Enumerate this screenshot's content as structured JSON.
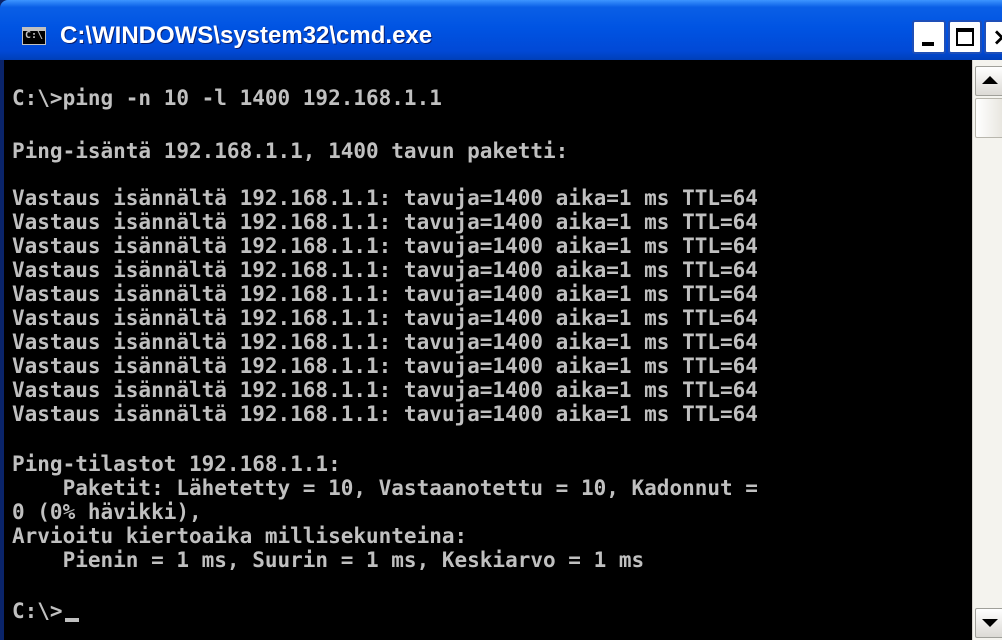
{
  "window": {
    "title": "C:\\WINDOWS\\system32\\cmd.exe",
    "icon_text": "C:\\"
  },
  "console": {
    "lines": [
      "C:\\>ping -n 10 -l 1400 192.168.1.1",
      "",
      "Ping-isäntä 192.168.1.1, 1400 tavun paketti:",
      "",
      "Vastaus isännältä 192.168.1.1: tavuja=1400 aika=1 ms TTL=64",
      "Vastaus isännältä 192.168.1.1: tavuja=1400 aika=1 ms TTL=64",
      "Vastaus isännältä 192.168.1.1: tavuja=1400 aika=1 ms TTL=64",
      "Vastaus isännältä 192.168.1.1: tavuja=1400 aika=1 ms TTL=64",
      "Vastaus isännältä 192.168.1.1: tavuja=1400 aika=1 ms TTL=64",
      "Vastaus isännältä 192.168.1.1: tavuja=1400 aika=1 ms TTL=64",
      "Vastaus isännältä 192.168.1.1: tavuja=1400 aika=1 ms TTL=64",
      "Vastaus isännältä 192.168.1.1: tavuja=1400 aika=1 ms TTL=64",
      "Vastaus isännältä 192.168.1.1: tavuja=1400 aika=1 ms TTL=64",
      "Vastaus isännältä 192.168.1.1: tavuja=1400 aika=1 ms TTL=64",
      "",
      "Ping-tilastot 192.168.1.1:",
      "    Paketit: Lähetetty = 10, Vastaanotettu = 10, Kadonnut =",
      "0 (0% hävikki),",
      "Arvioitu kiertoaika millisekunteina:",
      "    Pienin = 1 ms, Suurin = 1 ms, Keskiarvo = 1 ms",
      "",
      "C:\\>"
    ]
  },
  "icons": {
    "app": "console-app-icon",
    "minimize": "minimize-icon",
    "maximize": "maximize-icon",
    "close": "close-icon"
  },
  "colors": {
    "console_bg": "#000000",
    "console_fg": "#c0c0c0",
    "titlebar": "#0054e3"
  }
}
